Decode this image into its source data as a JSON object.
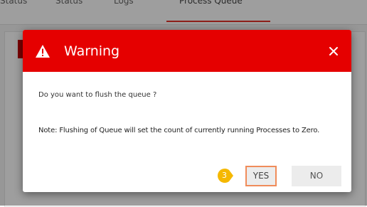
{
  "background": {
    "tabs": [
      "Status",
      "Status",
      "Logs",
      "Process Queue"
    ]
  },
  "dialog": {
    "title": "Warning",
    "header_color": "#e50000",
    "icon": "warning-triangle-icon",
    "close_icon": "close-icon",
    "message": "Do you want to flush the queue ?",
    "note": "Note: Flushing of Queue will set the count of currently running Processes to Zero.",
    "step_badge": "3",
    "yes_label": "YES",
    "no_label": "NO"
  }
}
